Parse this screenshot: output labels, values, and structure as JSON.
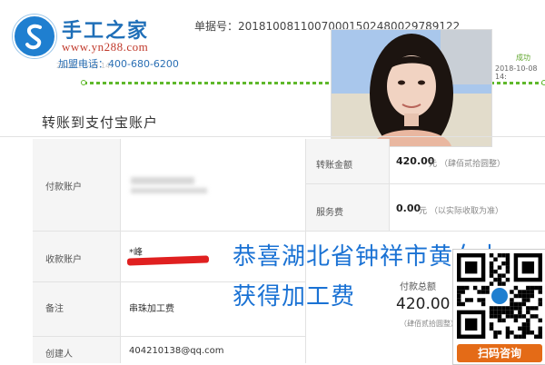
{
  "brand": {
    "name": "手工之家",
    "url": "www.yn288.com",
    "phone": "加盟电话：400-680-6200"
  },
  "order": {
    "number": "单据号：20181008110070001502480029789122",
    "status": "成功",
    "status_time": "2018-10-08 14:",
    "behind_logo_time": "2018-10-08 14:"
  },
  "section": {
    "title": "转账到支付宝账户"
  },
  "table": {
    "payer_label": "付款账户",
    "payee_label": "收款账户",
    "payee_value": "*峰",
    "note_label": "备注",
    "note_value": "串珠加工费",
    "creator_label": "创建人",
    "creator_value": "404210138@qq.com",
    "transfer_amount_label": "转账金额",
    "transfer_amount_value": "420.00",
    "transfer_amount_unit": "元",
    "transfer_amount_words": "（肆佰贰拾圆整）",
    "fee_label": "服务费",
    "fee_value": "0.00",
    "fee_unit": "元",
    "fee_note": "（以实际收取为准）",
    "total_label": "付款总额",
    "total_value": "420.00",
    "total_words": "（肆佰贰拾圆整）"
  },
  "overlay": {
    "line1": "恭喜湖北省钟祥市黄女士",
    "line2": "获得加工费"
  },
  "qr": {
    "caption": "扫码咨询"
  },
  "colors": {
    "brand_blue": "#1f6fb8",
    "progress_green": "#5fb82b",
    "overlay_blue": "#1a72d4",
    "qr_orange": "#e46b17",
    "redact_red": "#e02020"
  }
}
